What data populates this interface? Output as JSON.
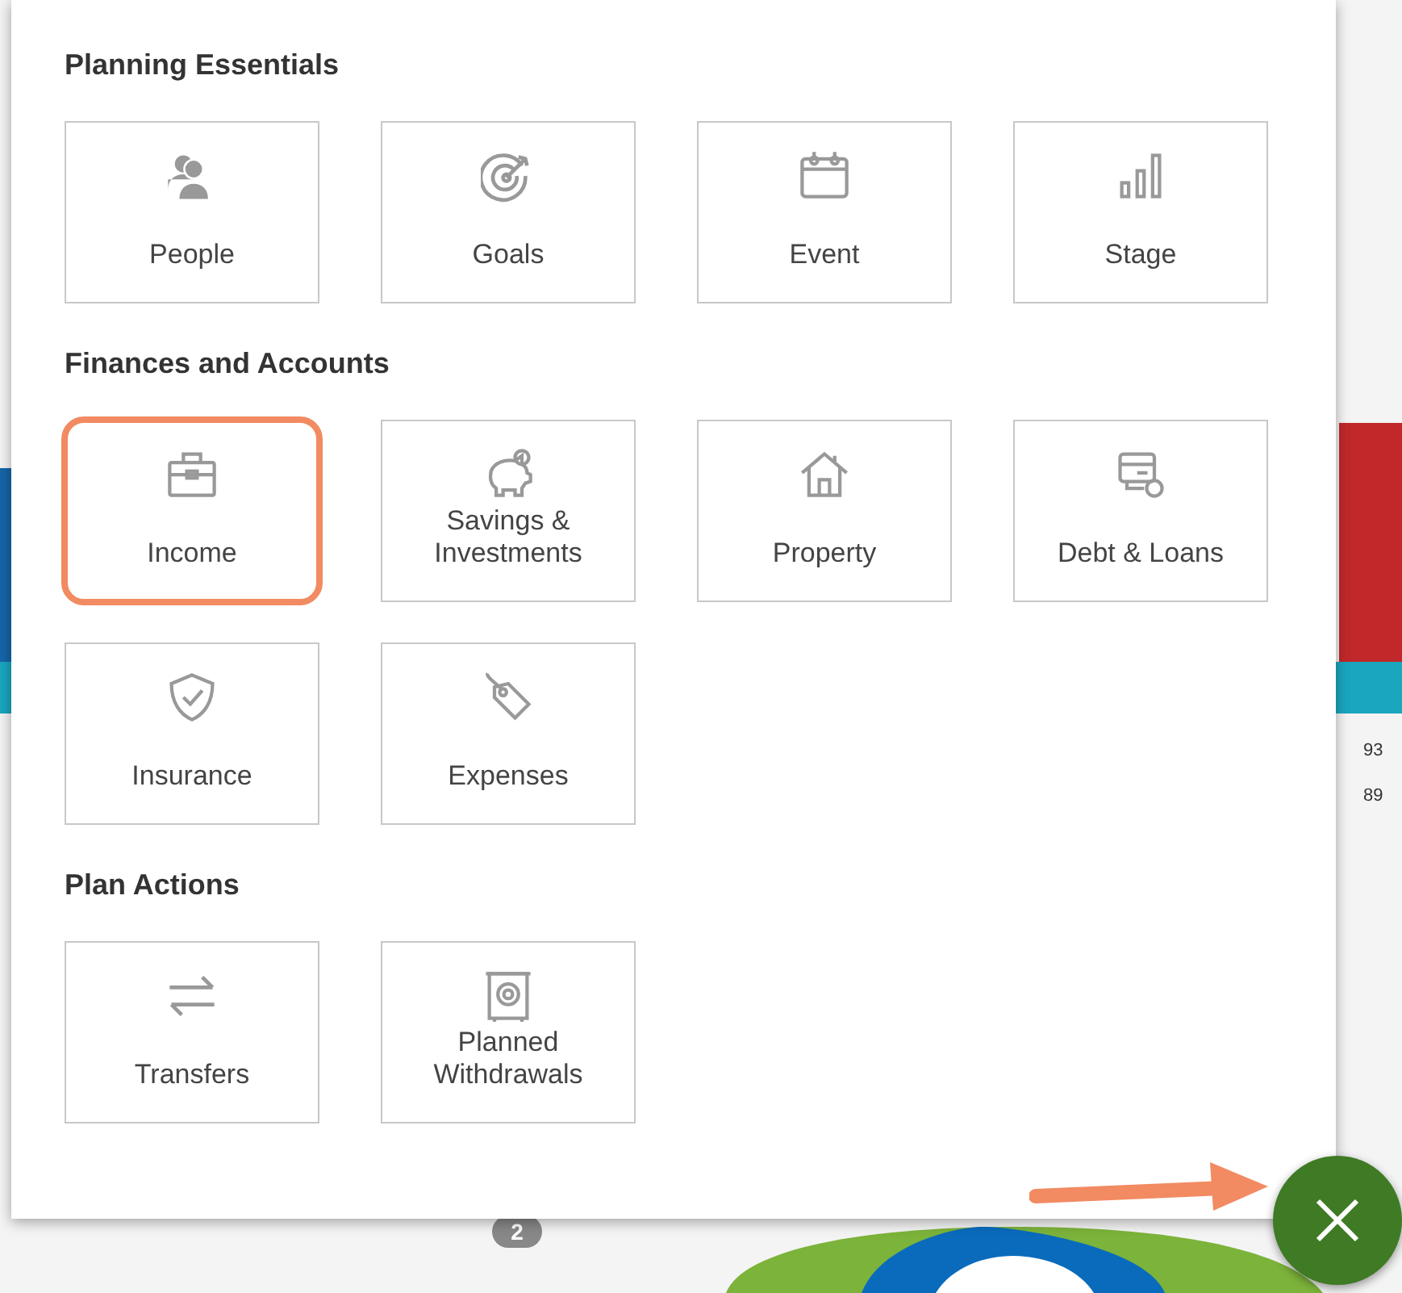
{
  "sections": [
    {
      "title": "Planning Essentials",
      "tiles": [
        {
          "label": "People",
          "highlighted": false
        },
        {
          "label": "Goals",
          "highlighted": false
        },
        {
          "label": "Event",
          "highlighted": false
        },
        {
          "label": "Stage",
          "highlighted": false
        }
      ]
    },
    {
      "title": "Finances and Accounts",
      "tiles": [
        {
          "label": "Income",
          "highlighted": true
        },
        {
          "label": "Savings & Investments",
          "highlighted": false
        },
        {
          "label": "Property",
          "highlighted": false
        },
        {
          "label": "Debt & Loans",
          "highlighted": false
        },
        {
          "label": "Insurance",
          "highlighted": false
        },
        {
          "label": "Expenses",
          "highlighted": false
        }
      ]
    },
    {
      "title": "Plan Actions",
      "tiles": [
        {
          "label": "Transfers",
          "highlighted": false
        },
        {
          "label": "Planned Withdrawals",
          "highlighted": false
        }
      ]
    }
  ],
  "background": {
    "values": [
      "93",
      "89"
    ],
    "badge": "2"
  },
  "close_button": {
    "annotated": true
  }
}
